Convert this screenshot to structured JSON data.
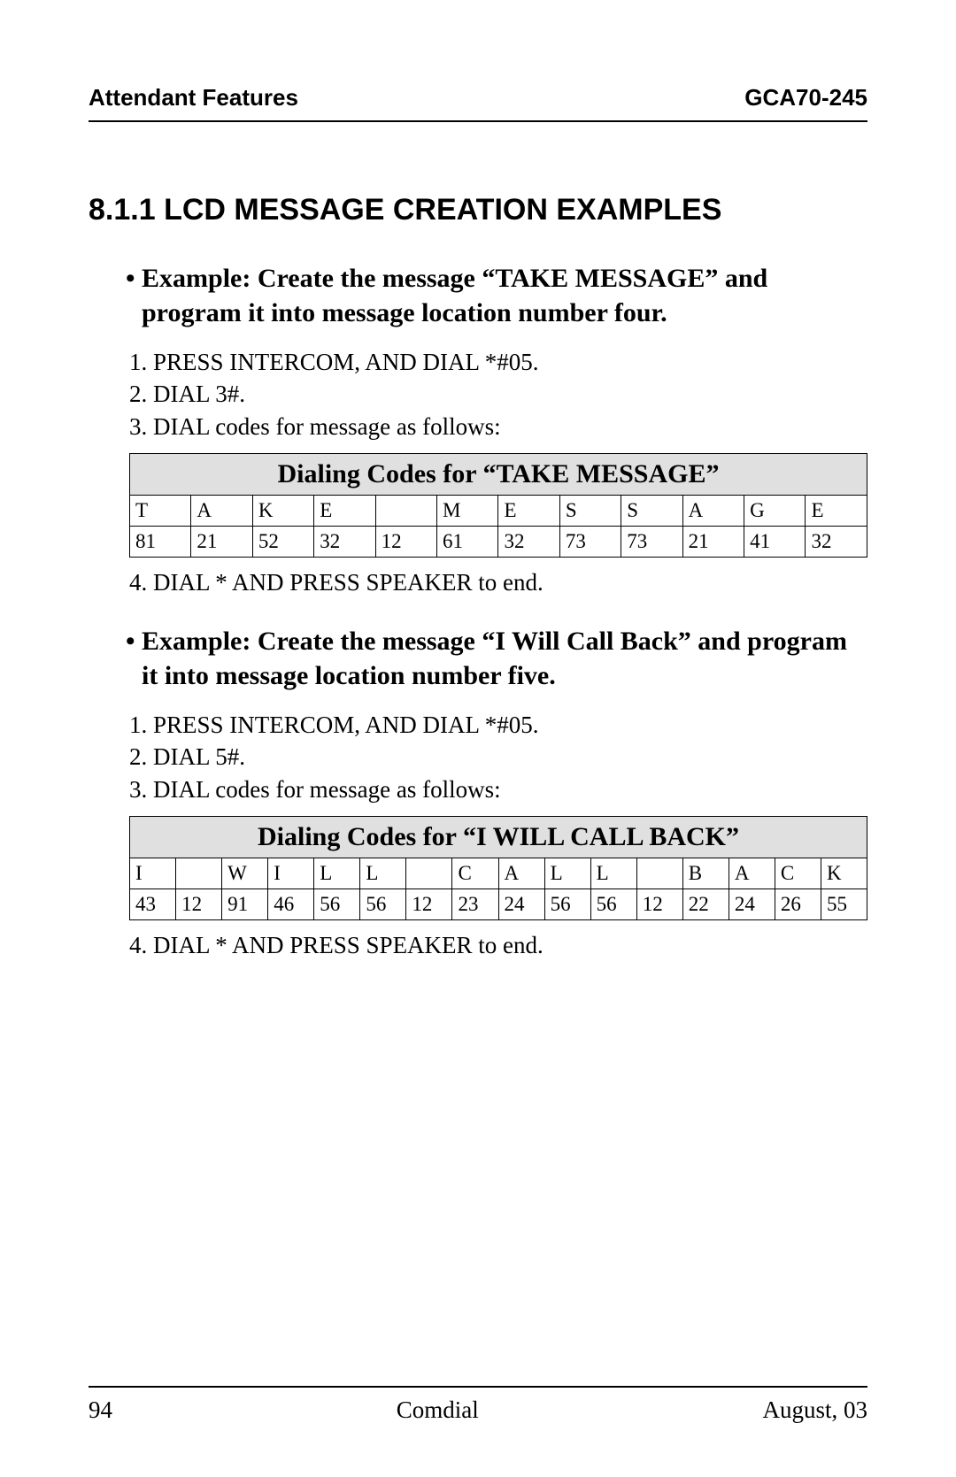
{
  "header": {
    "left": "Attendant Features",
    "right": "GCA70-245"
  },
  "heading": "8.1.1  LCD  MESSAGE CREATION EXAMPLES",
  "example1": {
    "title": "Example: Create the message “TAKE MESSAGE” and program it into message location number four.",
    "s1": "1.  PRESS INTERCOM, AND DIAL  *#05.",
    "s2": "2.  DIAL  3#.",
    "s3": "3.  DIAL codes for message as follows:",
    "s4": "4.  DIAL  *  AND PRESS SPEAKER to end."
  },
  "table1": {
    "title": "Dialing Codes for “TAKE MESSAGE”",
    "letters": [
      "T",
      "A",
      "K",
      "E",
      "",
      "M",
      "E",
      "S",
      "S",
      "A",
      "G",
      "E"
    ],
    "codes": [
      "81",
      "21",
      "52",
      "32",
      "12",
      "61",
      "32",
      "73",
      "73",
      "21",
      "41",
      "32"
    ]
  },
  "example2": {
    "title": "Example: Create the message “I Will Call Back” and program it into message location number five.",
    "s1": "1.  PRESS INTERCOM, AND DIAL  *#05.",
    "s2": "2.  DIAL  5#.",
    "s3": "3.  DIAL codes for message as follows:",
    "s4": "4.  DIAL  *  AND PRESS SPEAKER to end."
  },
  "table2": {
    "title": "Dialing Codes for “I WILL CALL BACK”",
    "letters": [
      "I",
      "",
      "W",
      "I",
      "L",
      "L",
      "",
      "C",
      "A",
      "L",
      "L",
      "",
      "B",
      "A",
      "C",
      "K"
    ],
    "codes": [
      "43",
      "12",
      "91",
      "46",
      "56",
      "56",
      "12",
      "23",
      "24",
      "56",
      "56",
      "12",
      "22",
      "24",
      "26",
      "55"
    ]
  },
  "footer": {
    "left": "94",
    "center": "Comdial",
    "right": "August, 03"
  },
  "chart_data": [
    {
      "type": "table",
      "title": "Dialing Codes for “TAKE MESSAGE”",
      "columns": [
        "T",
        "A",
        "K",
        "E",
        "",
        "M",
        "E",
        "S",
        "S",
        "A",
        "G",
        "E"
      ],
      "rows": [
        [
          "81",
          "21",
          "52",
          "32",
          "12",
          "61",
          "32",
          "73",
          "73",
          "21",
          "41",
          "32"
        ]
      ]
    },
    {
      "type": "table",
      "title": "Dialing Codes for “I WILL CALL BACK”",
      "columns": [
        "I",
        "",
        "W",
        "I",
        "L",
        "L",
        "",
        "C",
        "A",
        "L",
        "L",
        "",
        "B",
        "A",
        "C",
        "K"
      ],
      "rows": [
        [
          "43",
          "12",
          "91",
          "46",
          "56",
          "56",
          "12",
          "23",
          "24",
          "56",
          "56",
          "12",
          "22",
          "24",
          "26",
          "55"
        ]
      ]
    }
  ]
}
